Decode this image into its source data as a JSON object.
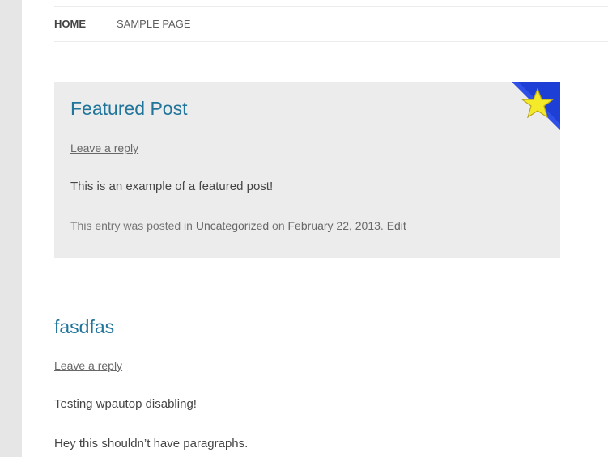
{
  "nav": {
    "items": [
      {
        "label": "Home"
      },
      {
        "label": "Sample Page"
      }
    ]
  },
  "featured_post": {
    "title": "Featured Post",
    "reply_label": "Leave a reply",
    "content": "This is an example of a featured post!",
    "meta": {
      "prefix": "This entry was posted in ",
      "category": "Uncategorized",
      "on_text": " on ",
      "date": "February 22, 2013",
      "separator": ". ",
      "edit_label": "Edit"
    },
    "badge_icon": "star-icon",
    "colors": {
      "badge_bg": "#1d3fd6",
      "star": "#f4ea2a"
    }
  },
  "post2": {
    "title": "fasdfas",
    "reply_label": "Leave a reply",
    "paragraphs": [
      "Testing wpautop disabling!",
      "Hey this shouldn’t have paragraphs."
    ]
  },
  "colors": {
    "link_title": "#21759b",
    "page_bg": "#e6e6e6"
  }
}
